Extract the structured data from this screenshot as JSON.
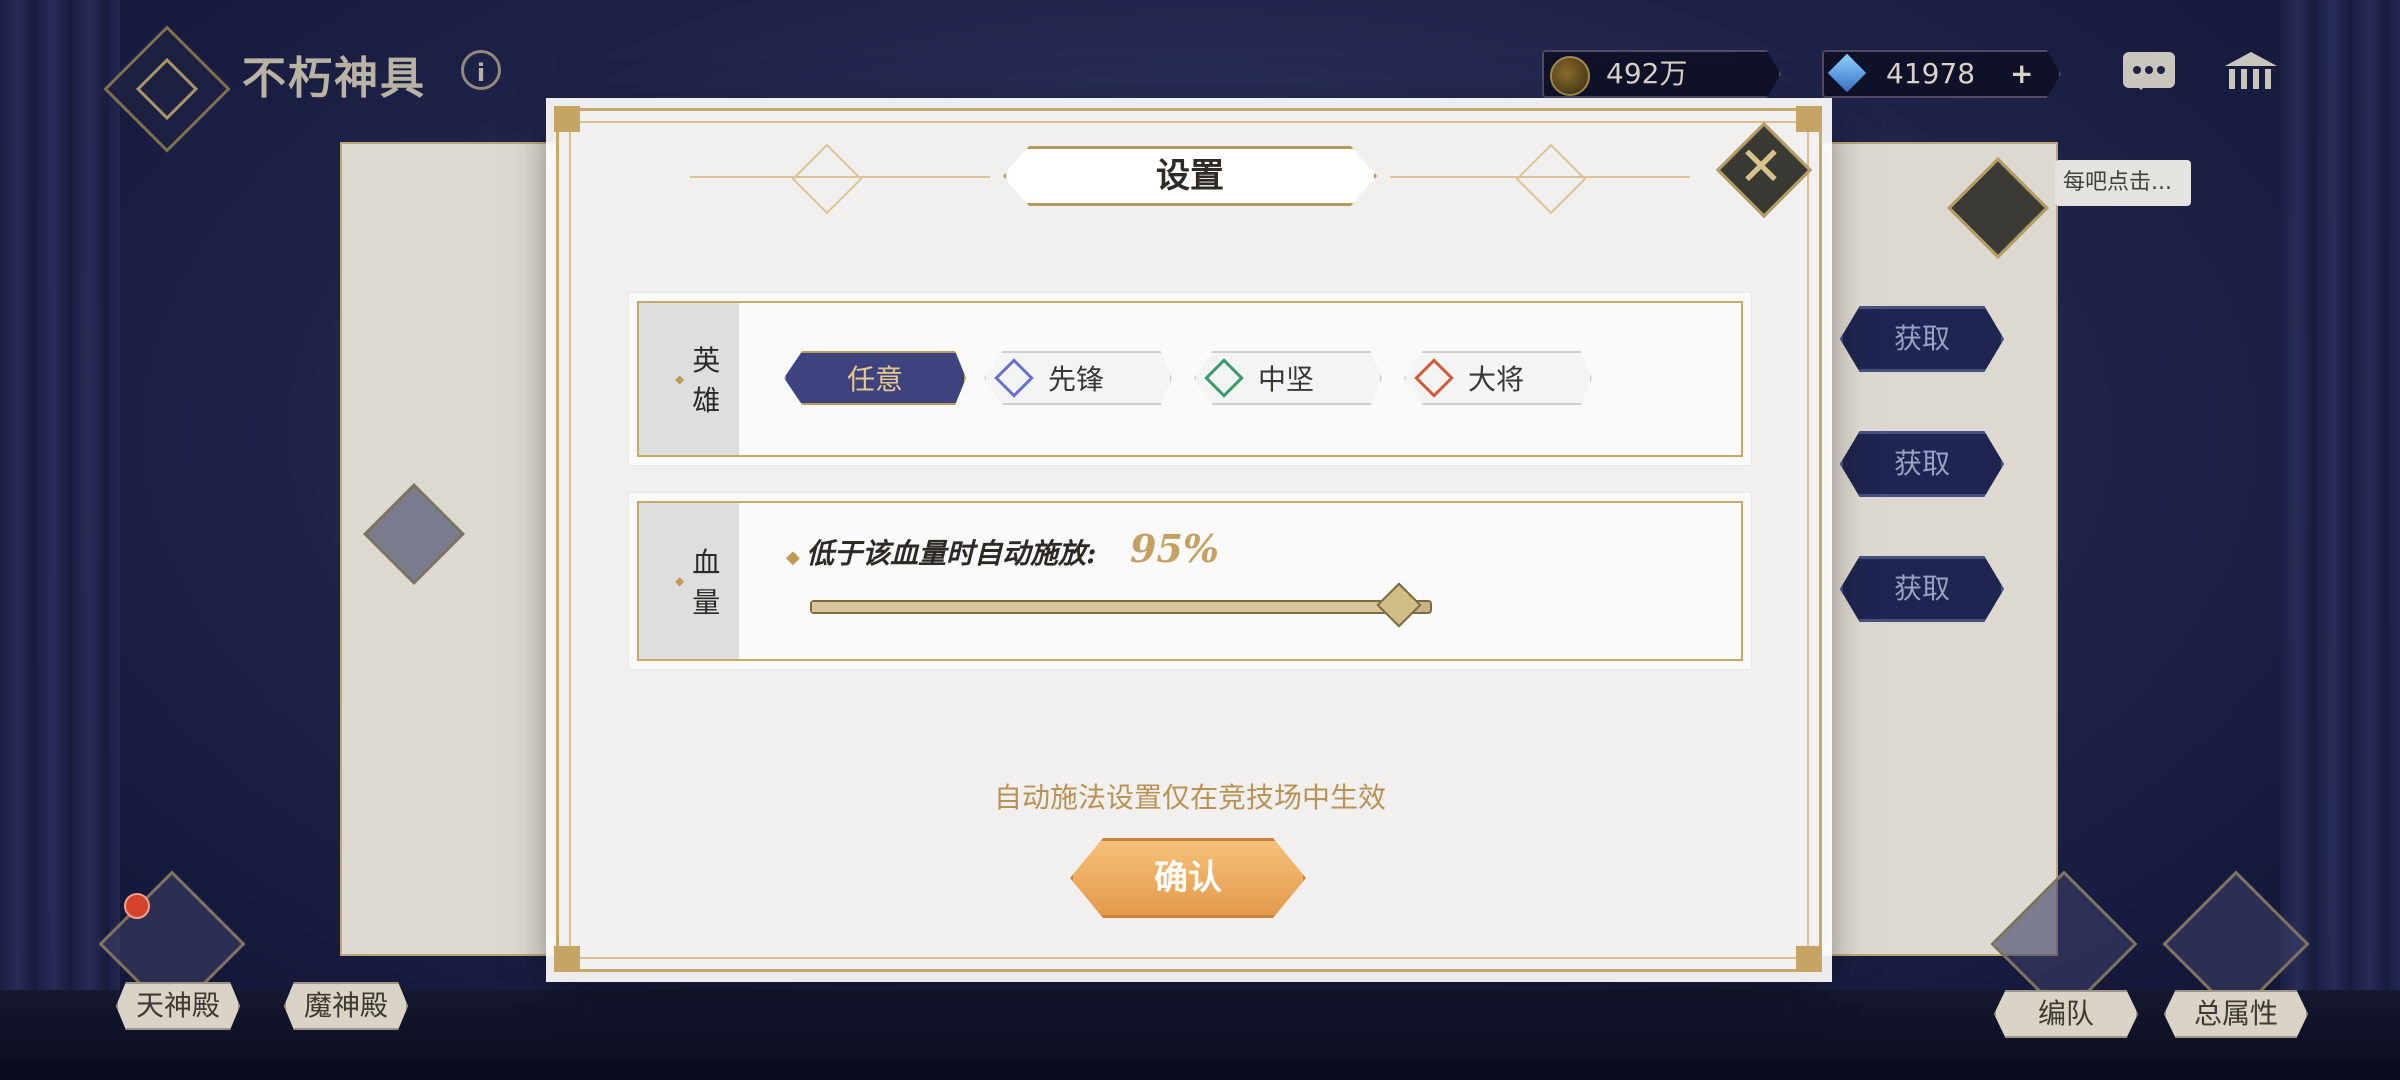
{
  "header": {
    "title": "不朽神具",
    "info_symbol": "i"
  },
  "currency": {
    "gold": "492万",
    "gems": "41978",
    "add_symbol": "+"
  },
  "background": {
    "get_buttons": [
      "获取",
      "获取",
      "获取"
    ],
    "tooltip": "每吧点击...",
    "bottom_tabs": [
      "天神殿",
      "魔神殿",
      "编队",
      "总属性"
    ]
  },
  "modal": {
    "title": "设置",
    "close_symbol": "✕",
    "hero_row": {
      "label": "英雄",
      "options": [
        "任意",
        "先锋",
        "中坚",
        "大将"
      ],
      "selected": "任意"
    },
    "hp_row": {
      "label": "血量",
      "caption": "低于该血量时自动施放:",
      "value_text": "95%",
      "value_fraction": 0.95
    },
    "notice": "自动施法设置仅在竞技场中生效",
    "confirm_label": "确认"
  },
  "colors": {
    "accent_gold": "#c8a96a",
    "selected_chip": "#3e4380",
    "confirm_orange": "#e49a4c"
  }
}
